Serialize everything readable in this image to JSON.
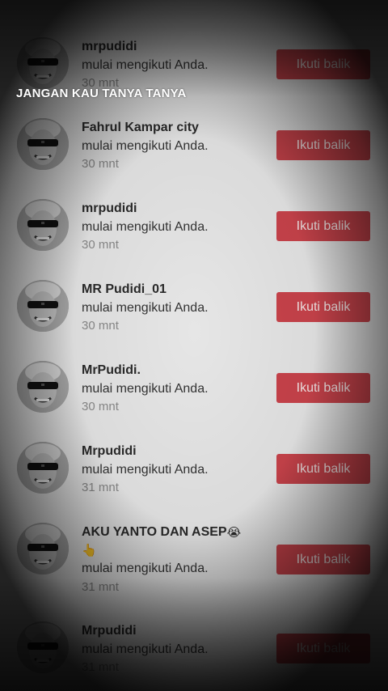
{
  "caption": "JANGAN KAU TANYA TANYA",
  "follow_label": "Ikuti balik",
  "colors": {
    "button": "#c9434b",
    "background": "#e6e6e6"
  },
  "notifications": [
    {
      "username": "mrpudidi",
      "action": "mulai mengikuti Anda.",
      "time": "30 mnt"
    },
    {
      "username": "Fahrul Kampar city",
      "action": "mulai mengikuti Anda.",
      "time": "30 mnt"
    },
    {
      "username": "mrpudidi",
      "action": "mulai mengikuti Anda.",
      "time": "30 mnt"
    },
    {
      "username": "MR Pudidi_01",
      "action": "mulai mengikuti Anda.",
      "time": "30 mnt"
    },
    {
      "username": "MrPudidi.",
      "action": "mulai mengikuti Anda.",
      "time": "30 mnt"
    },
    {
      "username": "Mrpudidi",
      "action": "mulai mengikuti Anda.",
      "time": "31 mnt"
    },
    {
      "username": "AKU YANTO DAN ASEP",
      "username_emoji": "😭",
      "username_line2": "👆",
      "action": "mulai mengikuti Anda.",
      "time": "31 mnt"
    },
    {
      "username": "Mrpudidi",
      "action": "mulai mengikuti Anda.",
      "time": "31 mnt"
    }
  ]
}
